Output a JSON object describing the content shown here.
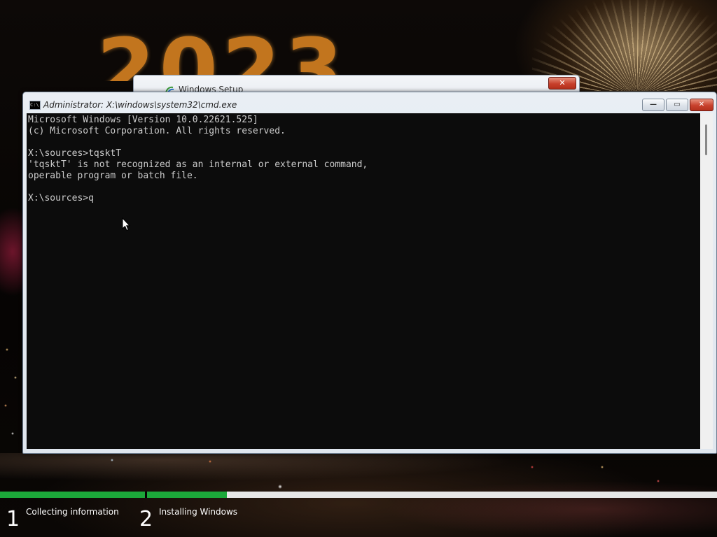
{
  "desktop": {
    "wallpaper_text": "2023"
  },
  "setup_window": {
    "title": "Windows Setup",
    "close_glyph": "✕"
  },
  "cmd_window": {
    "title": "Administrator: X:\\windows\\system32\\cmd.exe",
    "icon_text": "C:\\",
    "caption_buttons": {
      "minimize": "—",
      "maximize": "▭",
      "close": "✕"
    },
    "console_lines": [
      "Microsoft Windows [Version 10.0.22621.525]",
      "(c) Microsoft Corporation. All rights reserved.",
      "",
      "X:\\sources>tqsktT",
      "'tqsktT' is not recognized as an internal or external command,",
      "operable program or batch file.",
      "",
      "X:\\sources>q"
    ]
  },
  "setup_progress": {
    "steps": [
      {
        "number": "1",
        "label": "Collecting information",
        "progress": 1.0
      },
      {
        "number": "2",
        "label": "Installing Windows",
        "progress": 0.14
      }
    ],
    "colors": {
      "fill": "#1ca83a",
      "track": "#e7e7e7"
    }
  }
}
